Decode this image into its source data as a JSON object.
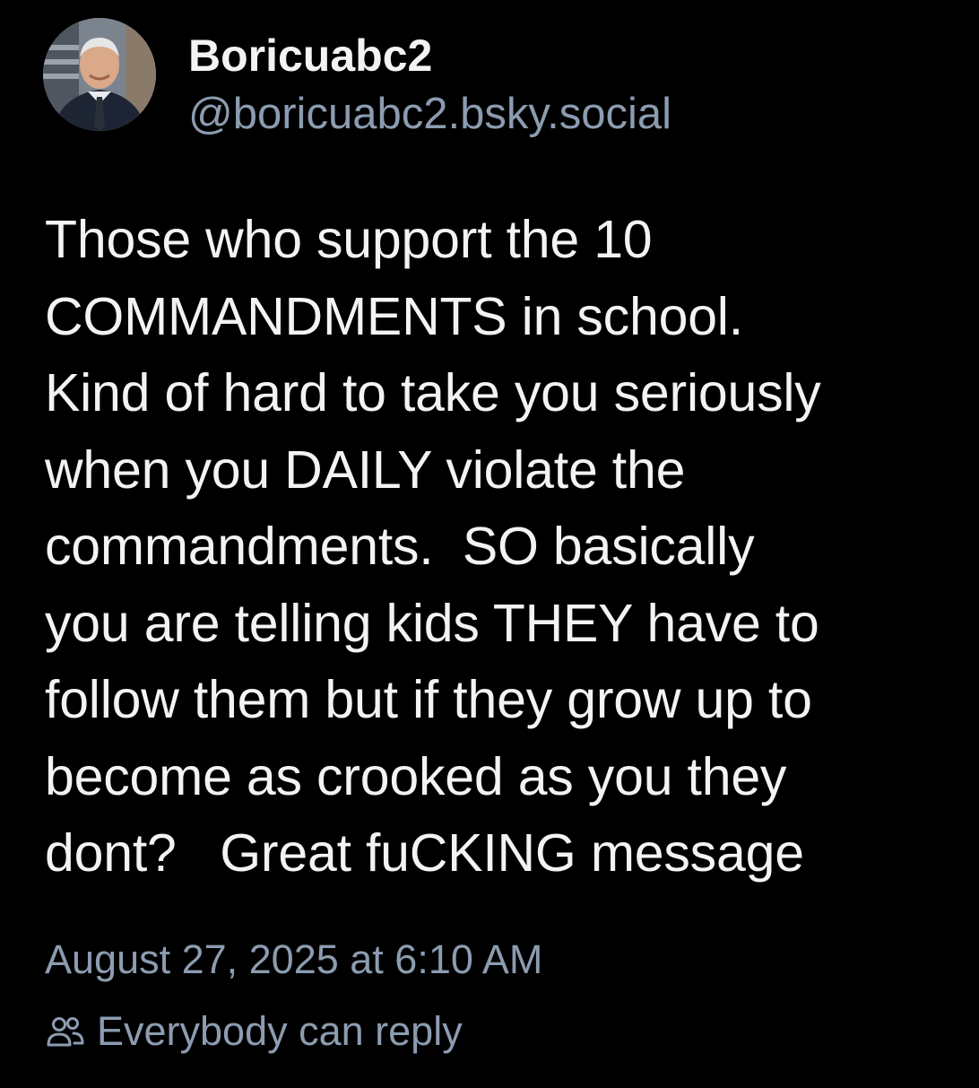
{
  "post": {
    "author": {
      "display_name": "Boricuabc2",
      "handle": "@boricuabc2.bsky.social"
    },
    "text_lines": [
      "Those who support the 10",
      "COMMANDMENTS in school.",
      "Kind of hard to take you seriously",
      "when you DAILY violate the",
      "commandments.  SO basically",
      "you are telling kids THEY have to",
      "follow them but if they grow up to",
      "become as crooked as you they",
      "dont?   Great fuCKING message"
    ],
    "timestamp": "August 27, 2025 at 6:10 AM",
    "reply_setting": {
      "icon": "people-icon",
      "label": "Everybody can reply"
    }
  },
  "colors": {
    "background": "#000000",
    "primary_text": "#f1f3f5",
    "secondary_text": "#8c9cb0"
  }
}
